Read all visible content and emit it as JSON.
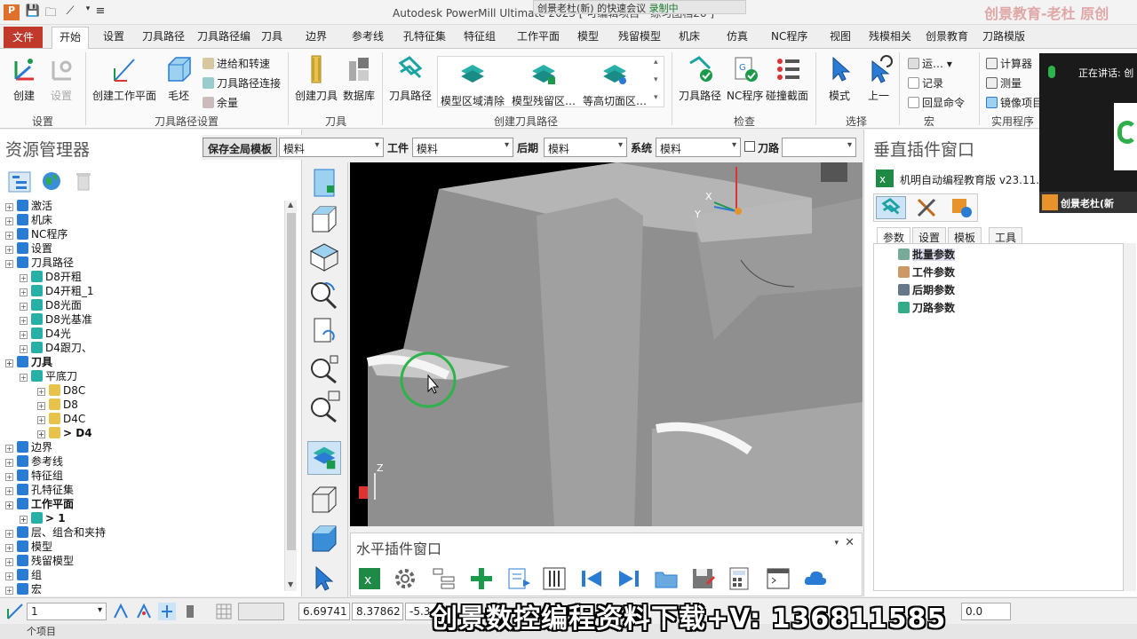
{
  "window": {
    "title": "Autodesk PowerMill Ultimate 2023",
    "title_suffix": "[ 可编辑项目 - 练习图档26 ]",
    "meeting_banner": "创景老杜(新) 的快速会议",
    "recording": "录制中",
    "watermark_top": "创景教育-老杜 原创"
  },
  "tabs": [
    "文件",
    "开始",
    "设置",
    "刀具路径",
    "刀具路径编",
    "刀具",
    "边界",
    "参考线",
    "孔特征集",
    "特征组",
    "工作平面",
    "模型",
    "残留模型",
    "机床",
    "仿真",
    "NC程序",
    "视图",
    "残模相关",
    "创景教育",
    "刀路模版"
  ],
  "ribbon": {
    "setup": {
      "create": "创建",
      "settings": "设置",
      "label": "设置"
    },
    "toolpath_setup": {
      "create_workplane": "创建工作平面",
      "block": "毛坯",
      "feeds": "进给和转速",
      "connections": "刀具路径连接",
      "thickness": "余量",
      "label": "刀具路径设置"
    },
    "tool": {
      "create_tool": "创建刀具",
      "database": "数据库",
      "label": "刀具"
    },
    "create_toolpath": {
      "toolpath": "刀具路径",
      "g1": "模型区域清除",
      "g2": "模型残留区…",
      "g3": "等高切面区…",
      "label": "创建刀具路径"
    },
    "check": {
      "toolpath": "刀具路径",
      "nc": "NC程序",
      "collision": "碰撞截面",
      "label": "检查"
    },
    "select": {
      "mode": "模式",
      "previous": "上一",
      "label": "选择"
    },
    "macro": {
      "run": "运…",
      "record": "记录",
      "echo": "回显命令",
      "label": "宏"
    },
    "utilities": {
      "calc": "计算器",
      "measure": "测量",
      "mirror": "镜像项目",
      "label": "实用程序"
    }
  },
  "explorer": {
    "title": "资源管理器",
    "items": [
      {
        "label": "激活",
        "level": 0,
        "bold": false
      },
      {
        "label": "机床",
        "level": 0,
        "bold": false
      },
      {
        "label": "NC程序",
        "level": 0,
        "bold": false
      },
      {
        "label": "设置",
        "level": 0,
        "bold": false
      },
      {
        "label": "刀具路径",
        "level": 0,
        "bold": false
      },
      {
        "label": "D8开粗",
        "level": 1,
        "bold": false
      },
      {
        "label": "D4开粗_1",
        "level": 1,
        "bold": false
      },
      {
        "label": "D8光面",
        "level": 1,
        "bold": false
      },
      {
        "label": "D8光基准",
        "level": 1,
        "bold": false
      },
      {
        "label": "D4光",
        "level": 1,
        "bold": false
      },
      {
        "label": "D4跟刀、",
        "level": 1,
        "bold": false
      },
      {
        "label": "刀具",
        "level": 0,
        "bold": true
      },
      {
        "label": "平底刀",
        "level": 1,
        "bold": false
      },
      {
        "label": "D8C",
        "level": 2,
        "bold": false
      },
      {
        "label": "D8",
        "level": 2,
        "bold": false
      },
      {
        "label": "D4C",
        "level": 2,
        "bold": false
      },
      {
        "label": "> D4",
        "level": 2,
        "bold": true
      },
      {
        "label": "边界",
        "level": 0,
        "bold": false
      },
      {
        "label": "参考线",
        "level": 0,
        "bold": false
      },
      {
        "label": "特征组",
        "level": 0,
        "bold": false
      },
      {
        "label": "孔特征集",
        "level": 0,
        "bold": false
      },
      {
        "label": "工作平面",
        "level": 0,
        "bold": true
      },
      {
        "label": "> 1",
        "level": 1,
        "bold": true
      },
      {
        "label": "层、组合和夹持",
        "level": 0,
        "bold": false
      },
      {
        "label": "模型",
        "level": 0,
        "bold": false
      },
      {
        "label": "残留模型",
        "level": 0,
        "bold": false
      },
      {
        "label": "组",
        "level": 0,
        "bold": false
      },
      {
        "label": "宏",
        "level": 0,
        "bold": false
      }
    ]
  },
  "toolbar2": {
    "save_template": "保存全局模板",
    "template_value": "模料",
    "workpiece_label": "工件",
    "workpiece_value": "模料",
    "post_label": "后期",
    "post_value": "模料",
    "system_label": "系统",
    "system_value": "模料",
    "toolpath_label": "刀路",
    "toolpath_value": ""
  },
  "hpanel": {
    "title": "水平插件窗口"
  },
  "vpanel": {
    "title": "垂直插件窗口",
    "plugin_name": "机明自动编程教育版 v23.11.2",
    "tabs": [
      "参数",
      "设置",
      "模板",
      "工具"
    ],
    "items": [
      "批量参数",
      "工件参数",
      "后期参数",
      "刀路参数"
    ]
  },
  "video": {
    "speaking": "正在讲话: 创",
    "name": "创景老杜(新"
  },
  "status": {
    "workplane": "1",
    "x": "6.69741",
    "y": "8.37862",
    "z": "-5.3",
    "tol": "0.0"
  },
  "bottom": {
    "label": "个项目"
  },
  "watermark_bottom": "创景数控编程资料下载+V: 13681158​5",
  "colors": {
    "file_tab": "#c0392b",
    "accent_green": "#1a9a4a",
    "accent_blue": "#2a7bd4",
    "model_grey": "#8a8a8a"
  }
}
